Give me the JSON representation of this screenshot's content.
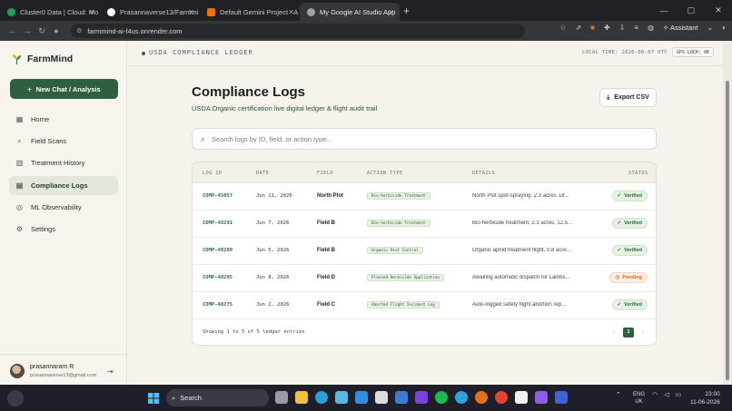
{
  "browser": {
    "tabs": [
      {
        "label": "Cluster0 Data | Cloud: Mo",
        "color": "#1f9d55"
      },
      {
        "label": "Prasannaverse13/Farmmi",
        "color": "#ffffff"
      },
      {
        "label": "Default Gemini Project - A",
        "color": "#e8710a"
      },
      {
        "label": "My Google AI Studio App",
        "color": "#9aa0a6"
      }
    ],
    "url": "farmmind-ai-f4us.onrender.com",
    "assistant_label": "Assistant"
  },
  "sidebar": {
    "brand": "FarmMind",
    "new_chat_label": "New Chat / Analysis",
    "items": [
      {
        "label": "Home",
        "icon": "grid-icon"
      },
      {
        "label": "Field Scans",
        "icon": "search-icon"
      },
      {
        "label": "Treatment History",
        "icon": "bar-chart-icon"
      },
      {
        "label": "Compliance Logs",
        "icon": "clipboard-icon"
      },
      {
        "label": "ML Observability",
        "icon": "brain-icon"
      },
      {
        "label": "Settings",
        "icon": "gear-icon"
      }
    ],
    "user": {
      "name": "prasannaram R",
      "email": "prasannaverse13@gmail.com"
    }
  },
  "topbar": {
    "title": "USDA COMPLIANCE LEDGER",
    "local_time": "LOCAL TIME: 2026-06-07 UTC",
    "gps": "GPS LOCK: OK"
  },
  "main": {
    "title": "Compliance Logs",
    "subtitle": "USDA Organic certification live digital ledger & flight audit trail",
    "export_label": "Export CSV",
    "search_placeholder": "Search logs by ID, field, or action type...",
    "columns": [
      "LOG ID",
      "DATE",
      "FIELD",
      "ACTION TYPE",
      "DETAILS",
      "STATUS"
    ],
    "rows": [
      {
        "id": "COMP-45057",
        "date": "Jun 11, 2026",
        "field": "North Plot",
        "action": "Bio-herbicide Treatment",
        "details": "North Plot spot-spraying, 2.3 acres. Dr...",
        "status": "Verified"
      },
      {
        "id": "COMP-48291",
        "date": "Jun 7, 2026",
        "field": "Field B",
        "action": "Bio-herbicide Treatment",
        "details": "Bio-herbicide treatment, 2.3 acres, 12.5...",
        "status": "Verified"
      },
      {
        "id": "COMP-48280",
        "date": "Jun 5, 2026",
        "field": "Field B",
        "action": "Organic Pest Control",
        "details": "Organic aphid treatment flight, 0.8 acre...",
        "status": "Verified"
      },
      {
        "id": "COMP-48295",
        "date": "Jun 8, 2026",
        "field": "Field D",
        "action": "Planned Herbicide Application",
        "details": "Awaiting automatic dispatch for Lambs...",
        "status": "Pending"
      },
      {
        "id": "COMP-48275",
        "date": "Jun 2, 2026",
        "field": "Field C",
        "action": "Aborted Flight Incident Log",
        "details": "Auto-logged safety flight abortion rep...",
        "status": "Verified"
      }
    ],
    "footer_text": "Showing 1 to 5 of 5 ledger entries",
    "page": "1"
  },
  "taskbar": {
    "search_label": "Search",
    "lang_1": "ENG",
    "lang_2": "UK",
    "time": "23:00",
    "date": "11-06-2026"
  },
  "colors": {
    "accent": "#2e5f3f",
    "verified": "#2e6a45",
    "pending": "#c26a2e"
  }
}
